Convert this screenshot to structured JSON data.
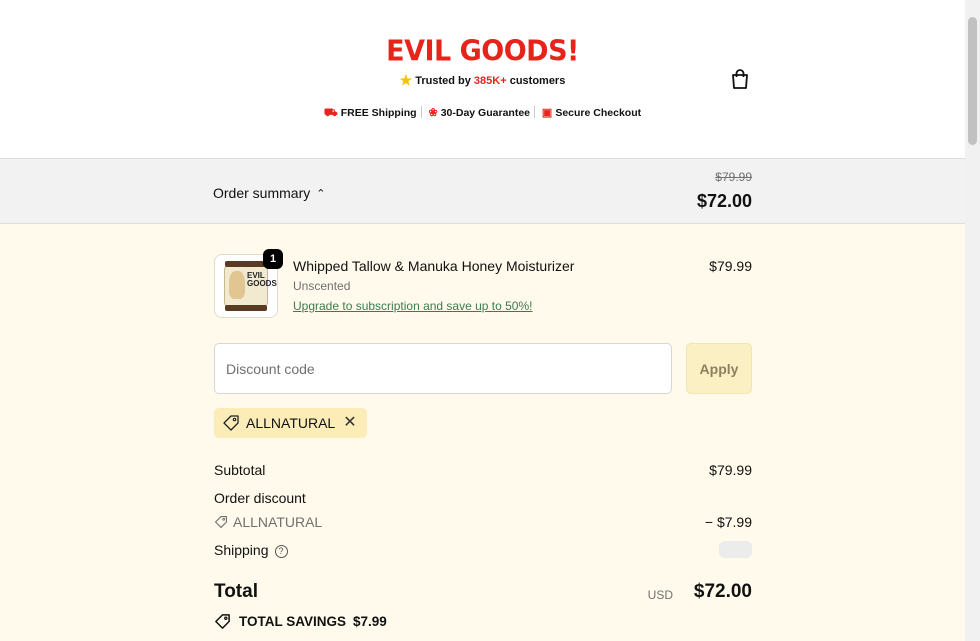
{
  "header": {
    "brand": "EVIL GOODS!",
    "trusted_prefix": "Trusted by ",
    "trusted_count": "385K+",
    "trusted_suffix": " customers",
    "badges": [
      {
        "icon": "truck-icon",
        "label": "FREE Shipping"
      },
      {
        "icon": "ribbon-icon",
        "label": "30-Day Guarantee"
      },
      {
        "icon": "lock-icon",
        "label": "Secure Checkout"
      }
    ],
    "cart_icon": "shopping-bag-icon"
  },
  "summary": {
    "toggle_label": "Order summary",
    "original_price": "$79.99",
    "current_price": "$72.00"
  },
  "product": {
    "quantity": "1",
    "name": "Whipped Tallow & Manuka Honey Moisturizer",
    "variant": "Unscented",
    "upgrade_link": "Upgrade to subscription and save up to 50%!",
    "price": "$79.99",
    "thumb_text": "EVIL GOODS"
  },
  "discount": {
    "placeholder": "Discount code",
    "value": "",
    "apply_label": "Apply",
    "applied_code": "ALLNATURAL"
  },
  "totals": {
    "subtotal_label": "Subtotal",
    "subtotal_value": "$79.99",
    "order_discount_label": "Order discount",
    "discount_code": "ALLNATURAL",
    "discount_value": "− $7.99",
    "shipping_label": "Shipping",
    "total_label": "Total",
    "currency": "USD",
    "total_value": "$72.00",
    "savings_label": "TOTAL SAVINGS",
    "savings_value": "$7.99"
  },
  "colors": {
    "brand_red": "#e8231c",
    "background_cream": "#fffaec",
    "chip_yellow": "#fbecb8",
    "link_green": "#3f7a4f"
  }
}
